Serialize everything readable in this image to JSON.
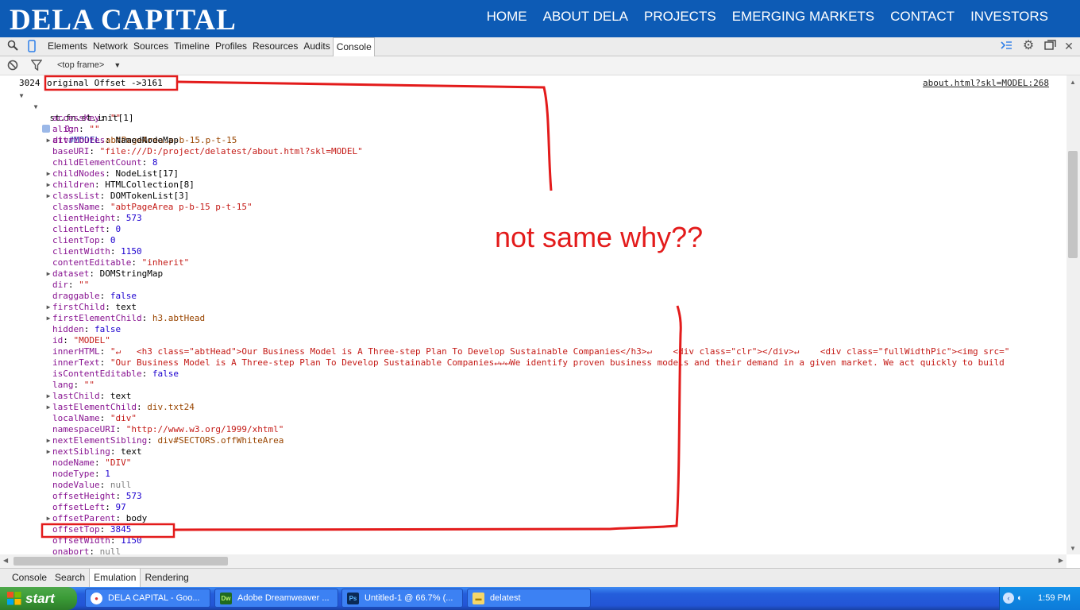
{
  "site": {
    "logo": "DELA CAPITAL",
    "nav": [
      "HOME",
      "ABOUT DELA",
      "PROJECTS",
      "EMERGING MARKETS",
      "CONTACT",
      "INVESTORS"
    ]
  },
  "devtools": {
    "tabs": [
      "Elements",
      "Network",
      "Sources",
      "Timeline",
      "Profiles",
      "Resources",
      "Audits",
      "Console"
    ],
    "active_tab": "Console",
    "frame": "<top frame>",
    "drawer_tabs": [
      "Console",
      "Search",
      "Emulation",
      "Rendering"
    ],
    "active_drawer_tab": "Emulation"
  },
  "console": {
    "log_count": "3024",
    "log_text": "original Offset ->3161",
    "source_link": "about.html?skl=MODEL:268",
    "object_line": "st.fn.st.init[1]",
    "root_key": "0:",
    "root_prefix": "div",
    "root_id": "#MODEL",
    "root_class": ".abtPageArea.p-b-15.p-t-15",
    "props": [
      {
        "key": "accessKey",
        "val": "\"\"",
        "type": "s",
        "expand": false
      },
      {
        "key": "align",
        "val": "\"\"",
        "type": "s",
        "expand": false
      },
      {
        "key": "attributes",
        "val": "NamedNodeMap",
        "type": "o",
        "expand": true
      },
      {
        "key": "baseURI",
        "val": "\"file:///D:/project/delatest/about.html?skl=MODEL\"",
        "type": "s",
        "expand": false
      },
      {
        "key": "childElementCount",
        "val": "8",
        "type": "n",
        "expand": false
      },
      {
        "key": "childNodes",
        "val": "NodeList[17]",
        "type": "o",
        "expand": true
      },
      {
        "key": "children",
        "val": "HTMLCollection[8]",
        "type": "o",
        "expand": true
      },
      {
        "key": "classList",
        "val": "DOMTokenList[3]",
        "type": "o",
        "expand": true
      },
      {
        "key": "className",
        "val": "\"abtPageArea p-b-15 p-t-15\"",
        "type": "s",
        "expand": false
      },
      {
        "key": "clientHeight",
        "val": "573",
        "type": "n",
        "expand": false
      },
      {
        "key": "clientLeft",
        "val": "0",
        "type": "n",
        "expand": false
      },
      {
        "key": "clientTop",
        "val": "0",
        "type": "n",
        "expand": false
      },
      {
        "key": "clientWidth",
        "val": "1150",
        "type": "n",
        "expand": false
      },
      {
        "key": "contentEditable",
        "val": "\"inherit\"",
        "type": "s",
        "expand": false
      },
      {
        "key": "dataset",
        "val": "DOMStringMap",
        "type": "o",
        "expand": true
      },
      {
        "key": "dir",
        "val": "\"\"",
        "type": "s",
        "expand": false
      },
      {
        "key": "draggable",
        "val": "false",
        "type": "n",
        "expand": false
      },
      {
        "key": "firstChild",
        "val": "text",
        "type": "o",
        "expand": true
      },
      {
        "key": "firstElementChild",
        "val": "h3.abtHead",
        "type": "c",
        "expand": true
      },
      {
        "key": "hidden",
        "val": "false",
        "type": "n",
        "expand": false
      },
      {
        "key": "id",
        "val": "\"MODEL\"",
        "type": "s",
        "expand": false
      },
      {
        "key": "innerHTML",
        "val": "\"↵   <h3 class=\"abtHead\">Our Business Model is A Three-step Plan To Develop Sustainable Companies</h3>↵    <div class=\"clr\"></div>↵    <div class=\"fullWidthPic\"><img src=\"",
        "type": "s",
        "expand": false
      },
      {
        "key": "innerText",
        "val": "\"Our Business Model is A Three-step Plan To Develop Sustainable Companies↵↵↵We identify proven business models and their demand in a given market. We act quickly to build",
        "type": "s",
        "expand": false
      },
      {
        "key": "isContentEditable",
        "val": "false",
        "type": "n",
        "expand": false
      },
      {
        "key": "lang",
        "val": "\"\"",
        "type": "s",
        "expand": false
      },
      {
        "key": "lastChild",
        "val": "text",
        "type": "o",
        "expand": true
      },
      {
        "key": "lastElementChild",
        "val": "div.txt24",
        "type": "c",
        "expand": true
      },
      {
        "key": "localName",
        "val": "\"div\"",
        "type": "s",
        "expand": false
      },
      {
        "key": "namespaceURI",
        "val": "\"http://www.w3.org/1999/xhtml\"",
        "type": "s",
        "expand": false
      },
      {
        "key": "nextElementSibling",
        "val": "div#SECTORS.offWhiteArea",
        "type": "c",
        "expand": true
      },
      {
        "key": "nextSibling",
        "val": "text",
        "type": "o",
        "expand": true
      },
      {
        "key": "nodeName",
        "val": "\"DIV\"",
        "type": "s",
        "expand": false
      },
      {
        "key": "nodeType",
        "val": "1",
        "type": "n",
        "expand": false
      },
      {
        "key": "nodeValue",
        "val": "null",
        "type": "g",
        "expand": false
      },
      {
        "key": "offsetHeight",
        "val": "573",
        "type": "n",
        "expand": false
      },
      {
        "key": "offsetLeft",
        "val": "97",
        "type": "n",
        "expand": false
      },
      {
        "key": "offsetParent",
        "val": "body",
        "type": "o",
        "expand": true
      },
      {
        "key": "offsetTop",
        "val": "3845",
        "type": "n",
        "expand": false
      },
      {
        "key": "offsetWidth",
        "val": "1150",
        "type": "n",
        "expand": false
      },
      {
        "key": "onabort",
        "val": "null",
        "type": "g",
        "expand": false
      }
    ]
  },
  "annotation": {
    "text": "not same why??",
    "color": "#e31b1b"
  },
  "taskbar": {
    "start": "start",
    "tasks": [
      "DELA CAPITAL - Goo...",
      "Adobe Dreamweaver ...",
      "Untitled-1 @ 66.7% (...",
      "delatest"
    ],
    "clock": "1:59 PM"
  }
}
